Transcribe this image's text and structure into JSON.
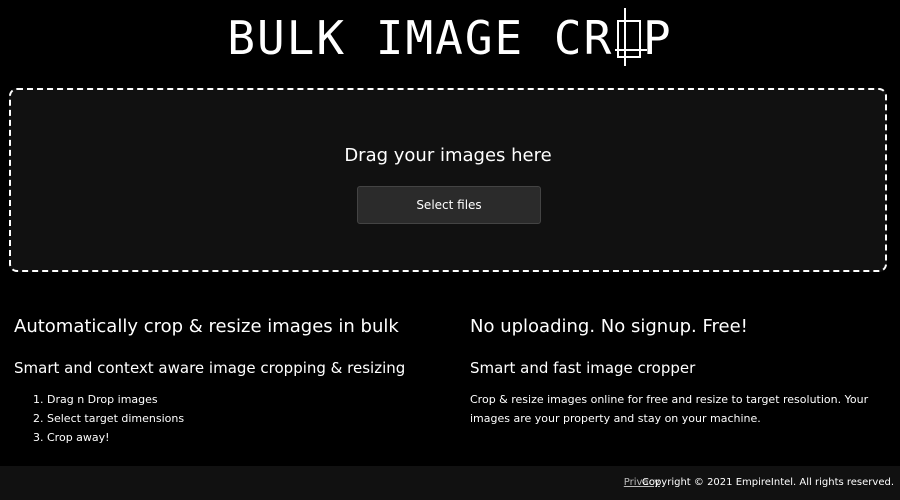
{
  "header": {
    "logo_part1": "BULK IMAGE CR",
    "logo_o": "O",
    "logo_part2": "P"
  },
  "dropzone": {
    "prompt": "Drag your images here",
    "select_button_label": "Select files"
  },
  "features": {
    "left": {
      "heading": "Automatically crop & resize images in bulk",
      "subheading": "Smart and context aware image cropping & resizing",
      "steps": [
        "Drag n Drop images",
        "Select target dimensions",
        "Crop away!"
      ]
    },
    "right": {
      "heading": "No uploading. No signup. Free!",
      "subheading": "Smart and fast image cropper",
      "description": "Crop & resize images online for free and resize to target resolution. Your images are your property and stay on your machine."
    }
  },
  "footer": {
    "privacy_link": "Privacy",
    "copyright": "Copyright © 2021 EmpireIntel. All rights reserved."
  },
  "colors": {
    "background": "#000000",
    "dropzone_bg": "#111111",
    "button_bg": "#2b2b2b",
    "text": "#ffffff"
  }
}
